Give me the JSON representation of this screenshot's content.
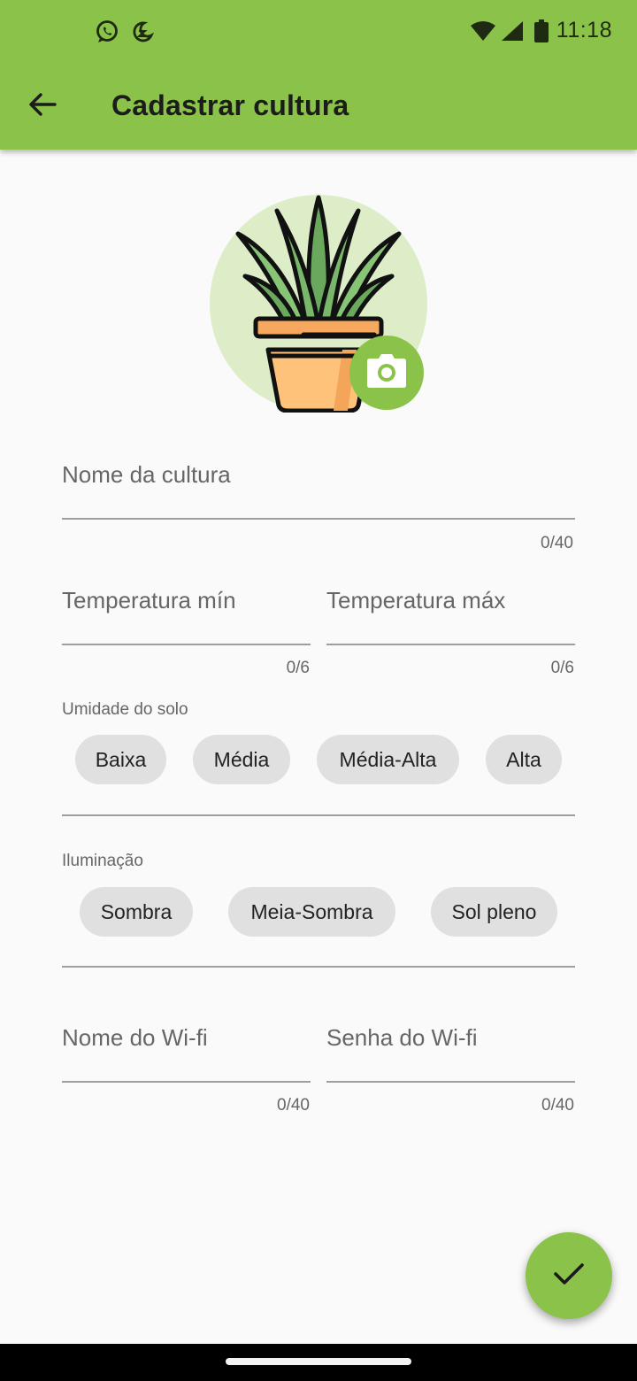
{
  "status_bar": {
    "time": "11:18",
    "left_icons": [
      "whatsapp-icon",
      "dnd-moon-icon"
    ],
    "right_icons": [
      "wifi-icon",
      "cell-signal-icon",
      "battery-icon"
    ]
  },
  "app_bar": {
    "title": "Cadastrar cultura",
    "back_icon": "arrow-back-icon"
  },
  "avatar": {
    "image": "potted-aloe-plant-illustration",
    "edit_icon": "camera-icon"
  },
  "form": {
    "name": {
      "label": "Nome da cultura",
      "value": "",
      "counter": "0/40"
    },
    "temp_min": {
      "label": "Temperatura mín",
      "value": "",
      "counter": "0/6"
    },
    "temp_max": {
      "label": "Temperatura máx",
      "value": "",
      "counter": "0/6"
    },
    "soil_moisture": {
      "label": "Umidade do solo",
      "options": [
        "Baixa",
        "Média",
        "Média-Alta",
        "Alta"
      ]
    },
    "lighting": {
      "label": "Iluminação",
      "options": [
        "Sombra",
        "Meia-Sombra",
        "Sol pleno"
      ]
    },
    "wifi_name": {
      "label": "Nome do Wi-fi",
      "value": "",
      "counter": "0/40"
    },
    "wifi_password": {
      "label": "Senha do Wi-fi",
      "value": "",
      "counter": "0/40"
    }
  },
  "fab": {
    "icon": "check-icon"
  },
  "colors": {
    "primary": "#8bc34a",
    "primary_light": "#dcedc8",
    "background": "#fafafa",
    "chip": "#e0e0e0",
    "underline": "#9e9e9e"
  }
}
